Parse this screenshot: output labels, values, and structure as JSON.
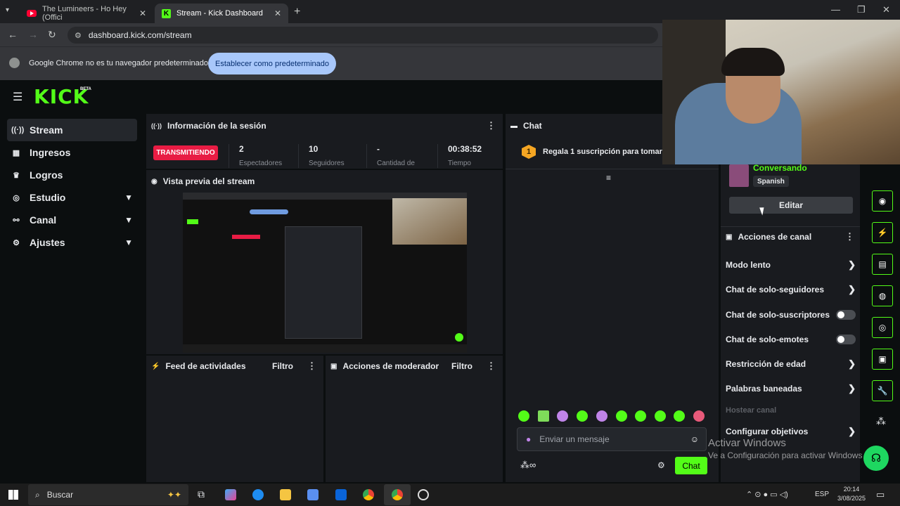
{
  "browser": {
    "tabs": [
      {
        "title": "The Lumineers - Ho Hey (Offici"
      },
      {
        "title": "Stream - Kick Dashboard"
      }
    ],
    "url": "dashboard.kick.com/stream",
    "infobar": {
      "text": "Google Chrome no es tu navegador predeterminado",
      "button": "Establecer como predeterminado"
    }
  },
  "kick": {
    "logo": "KICK",
    "beta": "BETA",
    "sidebar": [
      {
        "label": "Stream",
        "icon": "signal-icon"
      },
      {
        "label": "Ingresos",
        "icon": "chart-icon"
      },
      {
        "label": "Logros",
        "icon": "trophy-icon"
      },
      {
        "label": "Estudio",
        "icon": "studio-icon"
      },
      {
        "label": "Canal",
        "icon": "channel-icon"
      },
      {
        "label": "Ajustes",
        "icon": "gear-icon"
      }
    ],
    "session": {
      "title": "Información de la sesión",
      "badge": "TRANSMITIENDO",
      "stats": [
        {
          "value": "2",
          "label": "Espectadores"
        },
        {
          "value": "10",
          "label": "Seguidores"
        },
        {
          "value": "-",
          "label": "Cantidad de"
        },
        {
          "value": "00:38:52",
          "label": "Tiempo"
        }
      ]
    },
    "preview": {
      "title": "Vista previa del stream"
    },
    "feed": {
      "title": "Feed de actividades",
      "filter": "Filtro"
    },
    "mod": {
      "title": "Acciones de moderador",
      "filter": "Filtro"
    },
    "chat": {
      "title": "Chat",
      "pinned": "Regala 1 suscripción para tomar la",
      "pinned_count": "1",
      "placeholder": "Enviar un mensaje",
      "send": "Chat"
    },
    "channel_info": {
      "category": "Conversando",
      "language": "Spanish",
      "edit": "Editar"
    },
    "actions": {
      "title": "Acciones de canal",
      "items": [
        {
          "label": "Modo lento",
          "type": "chevron"
        },
        {
          "label": "Chat de solo-seguidores",
          "type": "chevron"
        },
        {
          "label": "Chat de solo-suscriptores",
          "type": "toggle"
        },
        {
          "label": "Chat de solo-emotes",
          "type": "toggle"
        },
        {
          "label": "Restricción de edad",
          "type": "chevron"
        },
        {
          "label": "Palabras baneadas",
          "type": "chevron"
        },
        {
          "label": "Hostear canal",
          "type": "disabled"
        },
        {
          "label": "Configurar objetivos",
          "type": "chevron"
        }
      ]
    }
  },
  "windows": {
    "watermark_title": "Activar Windows",
    "watermark_sub": "Ve a Configuración para activar Windows.",
    "search": "Buscar",
    "lang": "ESP",
    "time": "20:14",
    "date": "3/08/2025"
  },
  "colors": {
    "kick_green": "#53fc18",
    "live_red": "#e81c44",
    "panel": "#191b1f"
  }
}
